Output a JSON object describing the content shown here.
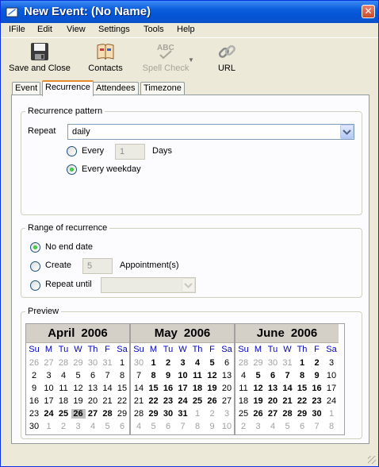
{
  "window": {
    "title": "New Event: (No Name)"
  },
  "menu": [
    "IFile",
    "Edit",
    "View",
    "Settings",
    "Tools",
    "Help"
  ],
  "toolbar": {
    "save_close": "Save and Close",
    "contacts": "Contacts",
    "spell_check": "Spell Check",
    "url": "URL"
  },
  "tabs": [
    "Event",
    "Recurrence",
    "Attendees",
    "Timezone"
  ],
  "active_tab": "Recurrence",
  "recurrence_pattern": {
    "legend": "Recurrence pattern",
    "repeat_label": "Repeat",
    "repeat_value": "daily",
    "every_label": "Every",
    "every_value": "1",
    "days_label": "Days",
    "every_weekday_label": "Every weekday",
    "selected": "Every weekday"
  },
  "range": {
    "legend": "Range of recurrence",
    "no_end_label": "No end date",
    "create_label": "Create",
    "create_value": "5",
    "appointments_label": "Appointment(s)",
    "repeat_until_label": "Repeat until",
    "repeat_until_value": "",
    "selected": "No end date"
  },
  "preview": {
    "legend": "Preview",
    "weekdays": [
      "Su",
      "M",
      "Tu",
      "W",
      "Th",
      "F",
      "Sa"
    ],
    "months": [
      {
        "name": "April",
        "year": "2006",
        "weeks": [
          [
            [
              "26",
              "o"
            ],
            [
              "27",
              "o"
            ],
            [
              "28",
              "o"
            ],
            [
              "29",
              "o"
            ],
            [
              "30",
              "o"
            ],
            [
              "31",
              "o"
            ],
            [
              "1",
              "n"
            ]
          ],
          [
            [
              "2",
              "n"
            ],
            [
              "3",
              "n"
            ],
            [
              "4",
              "n"
            ],
            [
              "5",
              "n"
            ],
            [
              "6",
              "n"
            ],
            [
              "7",
              "n"
            ],
            [
              "8",
              "n"
            ]
          ],
          [
            [
              "9",
              "n"
            ],
            [
              "10",
              "n"
            ],
            [
              "11",
              "n"
            ],
            [
              "12",
              "n"
            ],
            [
              "13",
              "n"
            ],
            [
              "14",
              "n"
            ],
            [
              "15",
              "n"
            ]
          ],
          [
            [
              "16",
              "n"
            ],
            [
              "17",
              "n"
            ],
            [
              "18",
              "n"
            ],
            [
              "19",
              "n"
            ],
            [
              "20",
              "n"
            ],
            [
              "21",
              "n"
            ],
            [
              "22",
              "n"
            ]
          ],
          [
            [
              "23",
              "n"
            ],
            [
              "24",
              "b"
            ],
            [
              "25",
              "b"
            ],
            [
              "26",
              "t"
            ],
            [
              "27",
              "b"
            ],
            [
              "28",
              "b"
            ],
            [
              "29",
              "n"
            ]
          ],
          [
            [
              "30",
              "n"
            ],
            [
              "1",
              "o"
            ],
            [
              "2",
              "o"
            ],
            [
              "3",
              "o"
            ],
            [
              "4",
              "o"
            ],
            [
              "5",
              "o"
            ],
            [
              "6",
              "o"
            ]
          ]
        ]
      },
      {
        "name": "May",
        "year": "2006",
        "weeks": [
          [
            [
              "30",
              "o"
            ],
            [
              "1",
              "b"
            ],
            [
              "2",
              "b"
            ],
            [
              "3",
              "b"
            ],
            [
              "4",
              "b"
            ],
            [
              "5",
              "b"
            ],
            [
              "6",
              "n"
            ]
          ],
          [
            [
              "7",
              "n"
            ],
            [
              "8",
              "b"
            ],
            [
              "9",
              "b"
            ],
            [
              "10",
              "b"
            ],
            [
              "11",
              "b"
            ],
            [
              "12",
              "b"
            ],
            [
              "13",
              "n"
            ]
          ],
          [
            [
              "14",
              "n"
            ],
            [
              "15",
              "b"
            ],
            [
              "16",
              "b"
            ],
            [
              "17",
              "b"
            ],
            [
              "18",
              "b"
            ],
            [
              "19",
              "b"
            ],
            [
              "20",
              "n"
            ]
          ],
          [
            [
              "21",
              "n"
            ],
            [
              "22",
              "b"
            ],
            [
              "23",
              "b"
            ],
            [
              "24",
              "b"
            ],
            [
              "25",
              "b"
            ],
            [
              "26",
              "b"
            ],
            [
              "27",
              "n"
            ]
          ],
          [
            [
              "28",
              "n"
            ],
            [
              "29",
              "b"
            ],
            [
              "30",
              "b"
            ],
            [
              "31",
              "b"
            ],
            [
              "1",
              "o"
            ],
            [
              "2",
              "o"
            ],
            [
              "3",
              "o"
            ]
          ],
          [
            [
              "4",
              "o"
            ],
            [
              "5",
              "o"
            ],
            [
              "6",
              "o"
            ],
            [
              "7",
              "o"
            ],
            [
              "8",
              "o"
            ],
            [
              "9",
              "o"
            ],
            [
              "10",
              "o"
            ]
          ]
        ]
      },
      {
        "name": "June",
        "year": "2006",
        "weeks": [
          [
            [
              "28",
              "o"
            ],
            [
              "29",
              "o"
            ],
            [
              "30",
              "o"
            ],
            [
              "31",
              "o"
            ],
            [
              "1",
              "b"
            ],
            [
              "2",
              "b"
            ],
            [
              "3",
              "n"
            ]
          ],
          [
            [
              "4",
              "n"
            ],
            [
              "5",
              "b"
            ],
            [
              "6",
              "b"
            ],
            [
              "7",
              "b"
            ],
            [
              "8",
              "b"
            ],
            [
              "9",
              "b"
            ],
            [
              "10",
              "n"
            ]
          ],
          [
            [
              "11",
              "n"
            ],
            [
              "12",
              "b"
            ],
            [
              "13",
              "b"
            ],
            [
              "14",
              "b"
            ],
            [
              "15",
              "b"
            ],
            [
              "16",
              "b"
            ],
            [
              "17",
              "n"
            ]
          ],
          [
            [
              "18",
              "n"
            ],
            [
              "19",
              "b"
            ],
            [
              "20",
              "b"
            ],
            [
              "21",
              "b"
            ],
            [
              "22",
              "b"
            ],
            [
              "23",
              "b"
            ],
            [
              "24",
              "n"
            ]
          ],
          [
            [
              "25",
              "n"
            ],
            [
              "26",
              "b"
            ],
            [
              "27",
              "b"
            ],
            [
              "28",
              "b"
            ],
            [
              "29",
              "b"
            ],
            [
              "30",
              "b"
            ],
            [
              "1",
              "o"
            ]
          ],
          [
            [
              "2",
              "o"
            ],
            [
              "3",
              "o"
            ],
            [
              "4",
              "o"
            ],
            [
              "5",
              "o"
            ],
            [
              "6",
              "o"
            ],
            [
              "7",
              "o"
            ],
            [
              "8",
              "o"
            ]
          ]
        ]
      }
    ]
  },
  "colors": {
    "titlebar": "#0a5cdb",
    "panel": "#ece9d8",
    "weekday_header": "#0000c0",
    "active_tab_accent": "#e68b2c"
  }
}
